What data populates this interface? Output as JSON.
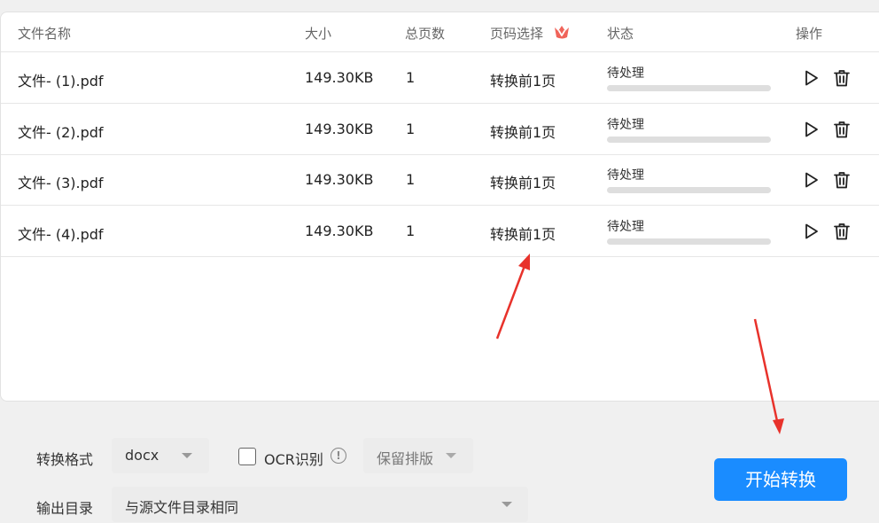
{
  "table": {
    "headers": {
      "name": "文件名称",
      "size": "大小",
      "pages": "总页数",
      "page_select": "页码选择",
      "status": "状态",
      "actions": "操作"
    },
    "rows": [
      {
        "name": "文件- (1).pdf",
        "size": "149.30KB",
        "pages": "1",
        "page_select": "转换前1页",
        "status": "待处理",
        "progress": 0
      },
      {
        "name": "文件- (2).pdf",
        "size": "149.30KB",
        "pages": "1",
        "page_select": "转换前1页",
        "status": "待处理",
        "progress": 0
      },
      {
        "name": "文件- (3).pdf",
        "size": "149.30KB",
        "pages": "1",
        "page_select": "转换前1页",
        "status": "待处理",
        "progress": 0
      },
      {
        "name": "文件- (4).pdf",
        "size": "149.30KB",
        "pages": "1",
        "page_select": "转换前1页",
        "status": "待处理",
        "progress": 0
      }
    ],
    "row_icons": [
      "play-icon",
      "trash-icon"
    ],
    "header_badge_icon": "crown-vip-icon"
  },
  "options": {
    "format_label": "转换格式",
    "format_value": "docx",
    "ocr_label": "OCR识别",
    "ocr_checked": false,
    "ocr_info_icon": "info-icon",
    "ocr_info_glyph": "!",
    "layout_value": "保留排版",
    "output_label": "输出目录",
    "output_value": "与源文件目录相同"
  },
  "start_button": "开始转换",
  "colors": {
    "accent": "#1a8cff",
    "annotation_arrow": "#e8322b",
    "vip_badge": "#f0645a"
  }
}
